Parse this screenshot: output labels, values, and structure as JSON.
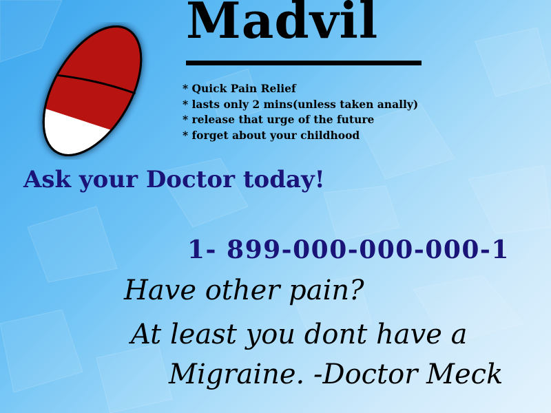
{
  "brand": {
    "name": "Madvil"
  },
  "features": [
    "Quick Pain Relief",
    "lasts only 2 mins(unless taken anally)",
    "release that urge of the future",
    "forget about your childhood"
  ],
  "call_to_action": "Ask your Doctor today!",
  "phone": "1- 899-000-000-000-1",
  "quote": {
    "line1": "Have other pain?",
    "line2": "At least you dont have a",
    "line3": "Migraine. -Doctor Meck"
  },
  "colors": {
    "pill_cap": "#b71310",
    "pill_body": "#ffffff",
    "text_accent": "#1a1378",
    "background_start": "#3aa6ee",
    "background_end": "#e3f3fd"
  },
  "icons": {
    "pill": "capsule-pill-icon"
  }
}
